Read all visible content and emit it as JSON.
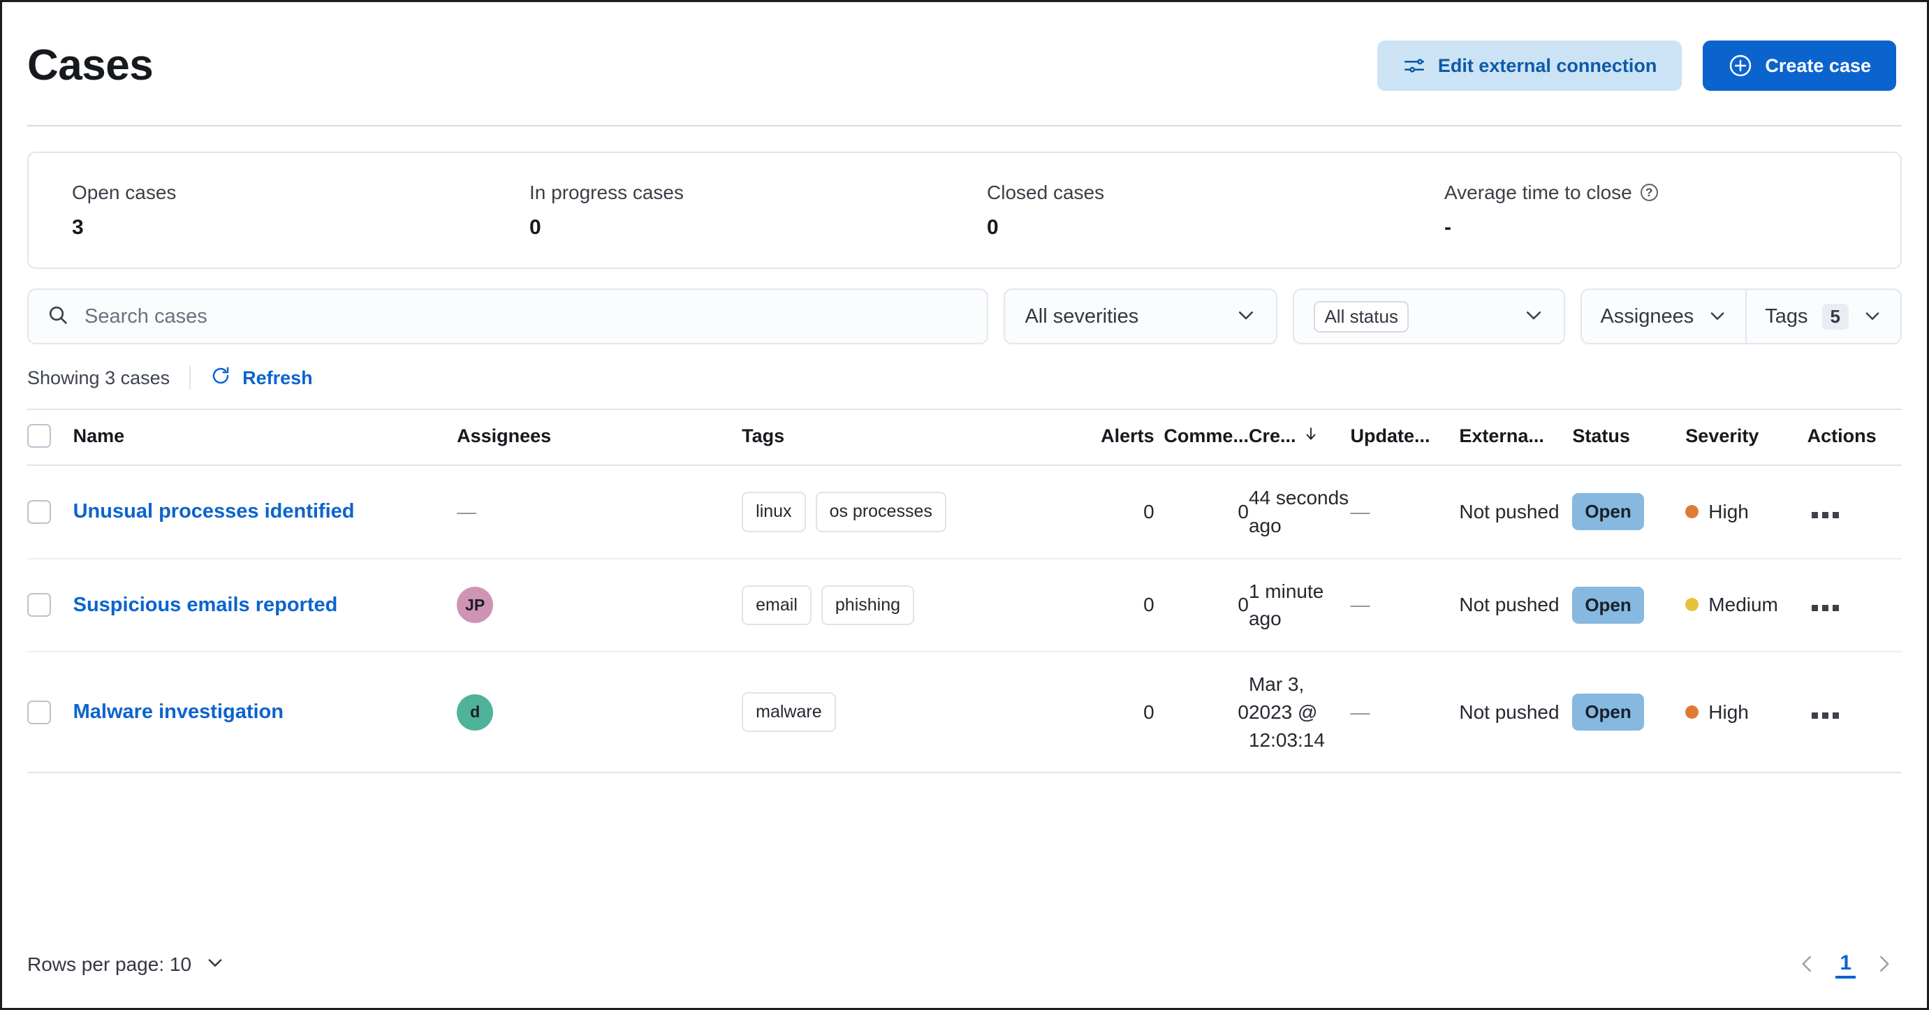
{
  "header": {
    "title": "Cases",
    "edit_connection_label": "Edit external connection",
    "create_case_label": "Create case"
  },
  "stats": [
    {
      "label": "Open cases",
      "value": "3",
      "has_help": false
    },
    {
      "label": "In progress cases",
      "value": "0",
      "has_help": false
    },
    {
      "label": "Closed cases",
      "value": "0",
      "has_help": false
    },
    {
      "label": "Average time to close",
      "value": "-",
      "has_help": true
    }
  ],
  "filters": {
    "search_placeholder": "Search cases",
    "search_value": "",
    "severity_label": "All severities",
    "status_label": "All status",
    "assignees_label": "Assignees",
    "tags_label": "Tags",
    "tags_count": "5"
  },
  "toolbar": {
    "showing_text": "Showing 3 cases",
    "refresh_label": "Refresh"
  },
  "table": {
    "columns": [
      "Name",
      "Assignees",
      "Tags",
      "Alerts",
      "Comme...",
      "Cre...",
      "Update...",
      "Externa...",
      "Status",
      "Severity",
      "Actions"
    ],
    "sorted_column": "Cre...",
    "sort_direction": "desc",
    "rows": [
      {
        "name": "Unusual processes identified",
        "assignee_initials": "",
        "assignee_color": "",
        "assignee_dash": "—",
        "tags": [
          "linux",
          "os processes"
        ],
        "alerts": "0",
        "comments": "0",
        "created": "44 seconds ago",
        "updated": "—",
        "external": "Not pushed",
        "status": "Open",
        "severity": "High",
        "severity_color": "#e07b36"
      },
      {
        "name": "Suspicious emails reported",
        "assignee_initials": "JP",
        "assignee_color": "#cf93b4",
        "assignee_dash": "",
        "tags": [
          "email",
          "phishing"
        ],
        "alerts": "0",
        "comments": "0",
        "created": "1 minute ago",
        "updated": "—",
        "external": "Not pushed",
        "status": "Open",
        "severity": "Medium",
        "severity_color": "#e5c33a"
      },
      {
        "name": "Malware investigation",
        "assignee_initials": "d",
        "assignee_color": "#4fb39a",
        "assignee_dash": "",
        "tags": [
          "malware"
        ],
        "alerts": "0",
        "comments": "0",
        "created": "Mar 3, 2023 @ 12:03:14",
        "updated": "—",
        "external": "Not pushed",
        "status": "Open",
        "severity": "High",
        "severity_color": "#e07b36"
      }
    ]
  },
  "footer": {
    "rows_per_page_label": "Rows per page: 10",
    "current_page": "1"
  },
  "colors": {
    "accent": "#0b64ce",
    "secondary_button_bg": "#cce3f5",
    "status_badge_bg": "#86b8e0"
  }
}
